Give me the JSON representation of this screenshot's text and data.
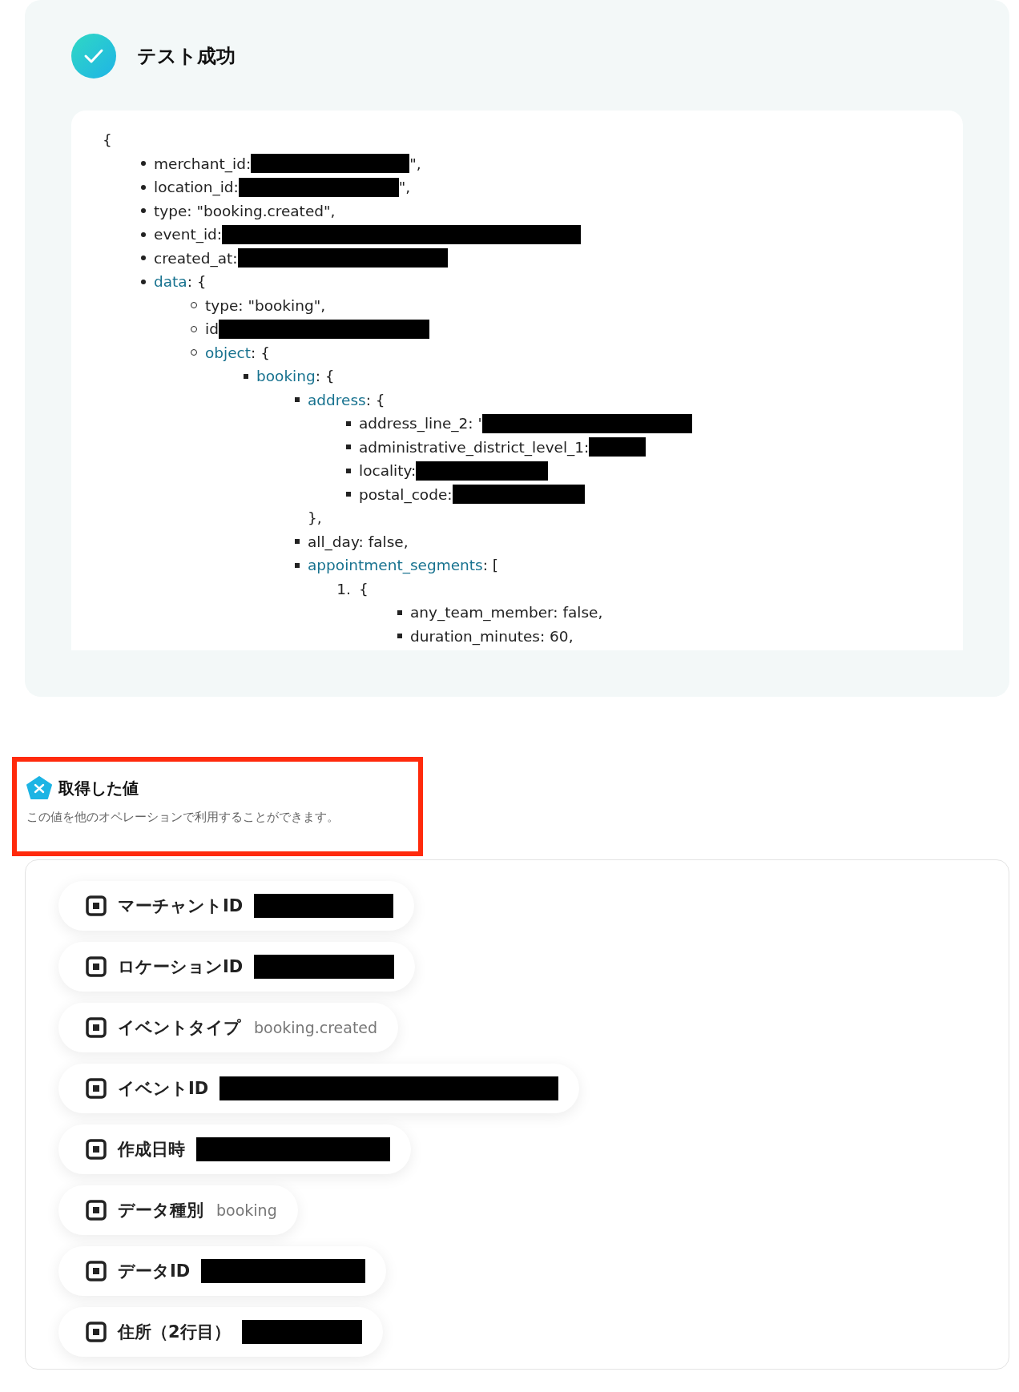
{
  "test_result": {
    "title": "テスト成功",
    "success": true
  },
  "output": {
    "open": "{",
    "items": [
      {
        "text": "merchant_id: ",
        "redacted": true,
        "suffix": "\","
      },
      {
        "text": "location_id:",
        "redacted": true,
        "suffix": "\","
      },
      {
        "text": "type: \"booking.created\","
      },
      {
        "text": "event_id:",
        "redacted": true
      },
      {
        "text": "created_at: ",
        "redacted": true
      },
      {
        "key": "data",
        "text": ": {",
        "children": [
          {
            "text": "type: \"booking\","
          },
          {
            "text": "id",
            "redacted": true
          },
          {
            "key": "object",
            "text": ": {",
            "children": [
              {
                "key": "booking",
                "text": ": {",
                "children": [
                  {
                    "key": "address",
                    "text": ": {",
                    "close": "},",
                    "children": [
                      {
                        "text": "address_line_2: '",
                        "redacted": true
                      },
                      {
                        "text": "administrative_district_level_1: ",
                        "redacted": true
                      },
                      {
                        "text": "locality: ",
                        "redacted": true
                      },
                      {
                        "text": "postal_code: ",
                        "redacted": true
                      }
                    ]
                  },
                  {
                    "text": "all_day: false,"
                  },
                  {
                    "key": "appointment_segments",
                    "text": ": [",
                    "children": [
                      {
                        "marker": "1.",
                        "text": "{",
                        "children": [
                          {
                            "text": "any_team_member: false,"
                          },
                          {
                            "text": "duration_minutes: 60,"
                          }
                        ]
                      }
                    ]
                  }
                ]
              }
            ]
          }
        ]
      }
    ]
  },
  "values_section": {
    "title": "取得した値",
    "description": "この値を他のオペレーションで利用することができます。",
    "highlighted": true
  },
  "values": [
    {
      "label": "マーチャントID",
      "redacted": true
    },
    {
      "label": "ロケーションID",
      "redacted": true
    },
    {
      "label": "イベントタイプ",
      "value": "booking.created"
    },
    {
      "label": "イベントID",
      "redacted": true
    },
    {
      "label": "作成日時",
      "redacted": true
    },
    {
      "label": "データ種別",
      "value": "booking"
    },
    {
      "label": "データID",
      "redacted": true
    },
    {
      "label": "住所（2行目）",
      "redacted": true
    }
  ]
}
